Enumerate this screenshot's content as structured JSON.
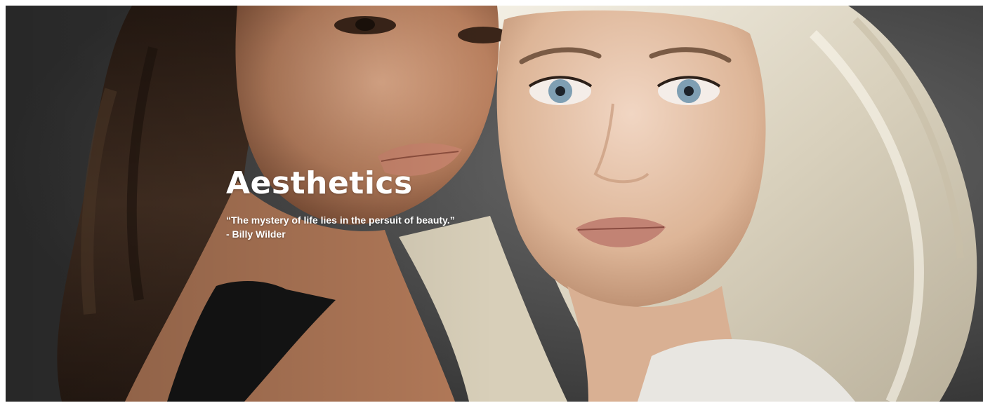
{
  "hero": {
    "title": "Aesthetics",
    "quote": "“The mystery of life lies in the persuit of beauty.”",
    "attribution": "- Billy Wilder",
    "image_alt": "two women with brunette and platinum blonde wavy hair",
    "colors": {
      "background": "#454545",
      "text": "#ffffff",
      "brunette_hair": "#3b2a20",
      "blonde_hair": "#e8e2d2",
      "skin_tan": "#c89272",
      "skin_fair": "#e2c1a8"
    }
  }
}
